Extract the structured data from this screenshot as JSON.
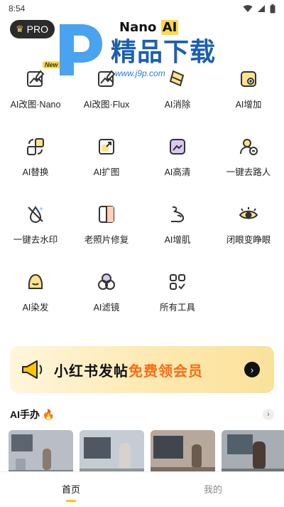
{
  "status": {
    "time": "8:54"
  },
  "header": {
    "pro_label": "PRO",
    "title_a": "Nano",
    "title_b": "AI"
  },
  "watermark": {
    "text": "精品下载",
    "url": "www.j9p.com"
  },
  "tools": [
    {
      "label": "AI改图·Nano",
      "icon": "image-edit-icon",
      "tag": "New"
    },
    {
      "label": "AI改图·Flux",
      "icon": "image-edit-icon"
    },
    {
      "label": "AI消除",
      "icon": "eraser-icon"
    },
    {
      "label": "AI增加",
      "icon": "add-object-icon"
    },
    {
      "label": "AI替换",
      "icon": "replace-icon"
    },
    {
      "label": "AI扩图",
      "icon": "expand-image-icon"
    },
    {
      "label": "AI高清",
      "icon": "hd-icon"
    },
    {
      "label": "一键去路人",
      "icon": "remove-person-icon"
    },
    {
      "label": "一键去水印",
      "icon": "remove-watermark-icon"
    },
    {
      "label": "老照片修复",
      "icon": "photo-restore-icon"
    },
    {
      "label": "AI增肌",
      "icon": "muscle-icon"
    },
    {
      "label": "闭眼变睁眼",
      "icon": "open-eye-icon"
    },
    {
      "label": "AI染发",
      "icon": "hair-dye-icon"
    },
    {
      "label": "AI滤镜",
      "icon": "filter-icon"
    },
    {
      "label": "所有工具",
      "icon": "all-tools-icon"
    }
  ],
  "banner": {
    "text_main": "小红书发帖",
    "text_highlight": "免费领会员"
  },
  "section": {
    "title": "AI手办 🔥"
  },
  "tabs": [
    {
      "label": "首页",
      "active": true
    },
    {
      "label": "我的",
      "active": false
    }
  ],
  "colors": {
    "accent": "#ffc400",
    "banner_highlight": "#ff6a14",
    "pro_bg": "#2b2b2b"
  }
}
